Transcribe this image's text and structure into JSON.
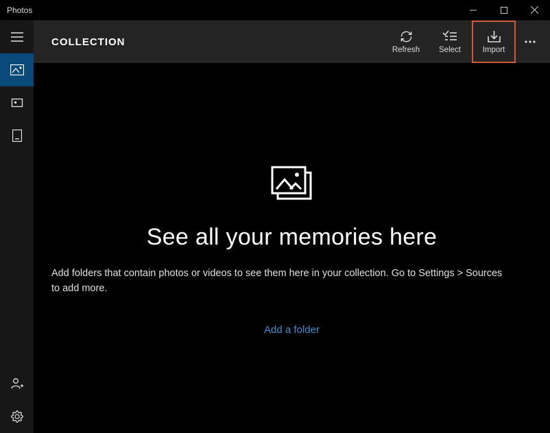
{
  "titlebar": {
    "app_name": "Photos"
  },
  "toolbar": {
    "title": "COLLECTION",
    "refresh_label": "Refresh",
    "select_label": "Select",
    "import_label": "Import"
  },
  "empty_state": {
    "headline": "See all your memories here",
    "sub": "Add folders that contain photos or videos to see them here in your collection. Go to Settings > Sources to add more.",
    "link": "Add a folder"
  },
  "highlight": {
    "color": "#d0593a"
  }
}
